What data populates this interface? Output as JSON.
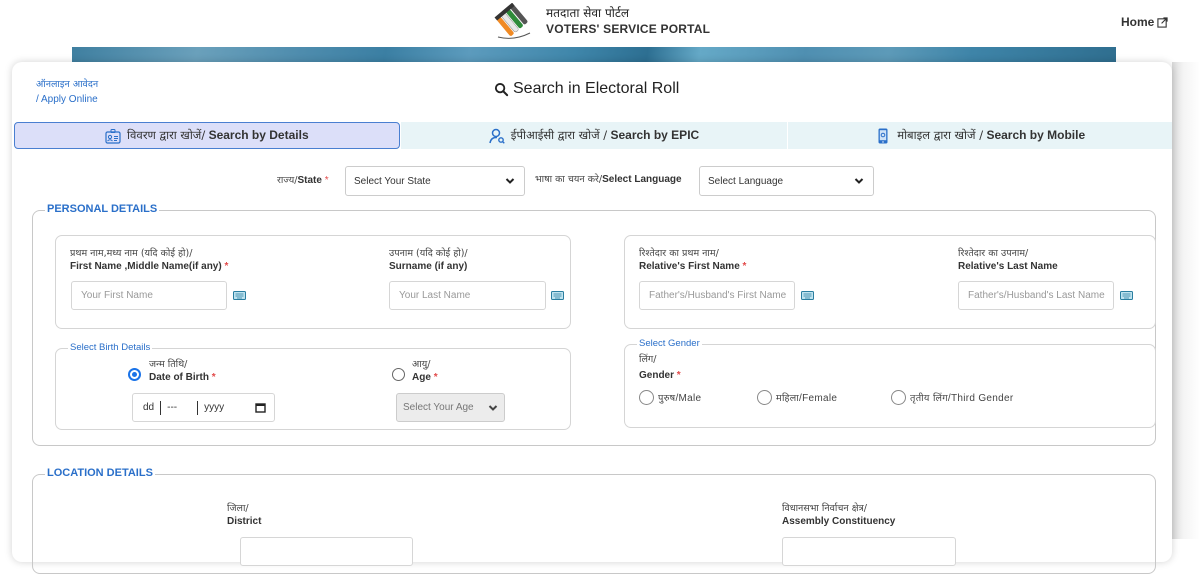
{
  "header": {
    "brand_hindi": "मतदाता सेवा पोर्टल",
    "brand_english": "VOTERS' SERVICE PORTAL",
    "home_label": "Home",
    "logo_icon": "eci-ballot-logo"
  },
  "card": {
    "apply_online_hindi": "ऑनलाइन आवेदन",
    "apply_online_english": "/ Apply Online",
    "title": "Search in Electoral Roll"
  },
  "tabs": [
    {
      "label_hindi": "विवरण द्वारा खोजें/",
      "label_english": "Search by Details",
      "icon": "id-card-icon",
      "active": true
    },
    {
      "label_hindi": "ईपीआईसी द्वारा खोजें /",
      "label_english": "Search by EPIC",
      "icon": "user-search-icon",
      "active": false
    },
    {
      "label_hindi": "मोबाइल द्वारा खोजें /",
      "label_english": "Search by Mobile",
      "icon": "mobile-icon",
      "active": false
    }
  ],
  "filters": {
    "state_label_hindi": "राज्य/",
    "state_label_english": "State",
    "state_value": "Select Your State",
    "language_label_hindi": "भाषा का चयन करे/",
    "language_label_english": "Select Language",
    "language_value": "Select Language"
  },
  "personal": {
    "legend": "PERSONAL DETAILS",
    "first_name": {
      "label_hindi": "प्रथम नाम,मध्य नाम (यदि कोई हो)/",
      "label_english": "First Name ,Middle Name(if any)",
      "placeholder": "Your First Name",
      "required": true
    },
    "surname": {
      "label_hindi": "उपनाम (यदि कोई हो)/",
      "label_english": "Surname (if any)",
      "placeholder": "Your Last Name",
      "required": false
    },
    "relative_first": {
      "label_hindi": "रिश्तेदार का प्रथम नाम/",
      "label_english": "Relative's First Name",
      "placeholder": "Father's/Husband's First Name",
      "required": true
    },
    "relative_last": {
      "label_hindi": "रिश्तेदार का उपनाम/",
      "label_english": "Relative's Last Name",
      "placeholder": "Father's/Husband's Last Name",
      "required": false
    },
    "birth": {
      "legend": "Select Birth Details",
      "dob_label_hindi": "जन्म तिथि/",
      "dob_label_english": "Date of Birth",
      "dob_selected": true,
      "date_dd": "dd",
      "date_mm": "---",
      "date_yyyy": "yyyy",
      "age_label_hindi": "आयु/",
      "age_label_english": "Age",
      "age_selected": false,
      "age_value": "Select Your Age"
    },
    "gender": {
      "legend": "Select Gender",
      "label_hindi": "लिंग/",
      "label_english": "Gender",
      "options": [
        {
          "hindi": "पुरुष",
          "english": "/Male",
          "selected": false
        },
        {
          "hindi": "महिला",
          "english": "/Female",
          "selected": false
        },
        {
          "hindi": "तृतीय लिंग",
          "english": "/Third Gender",
          "selected": false
        }
      ]
    }
  },
  "location": {
    "legend": "LOCATION DETAILS",
    "district_label_hindi": "जिला/",
    "district_label_english": "District",
    "assembly_label_hindi": "विधानसभा निर्वाचन क्षेत्र/",
    "assembly_label_english": "Assembly Constituency"
  },
  "colors": {
    "accent_blue": "#2a6fc9",
    "active_tab_bg": "#dcdff9",
    "inactive_tab_bg": "#e8f4f7",
    "required_star": "#e24a4a"
  }
}
